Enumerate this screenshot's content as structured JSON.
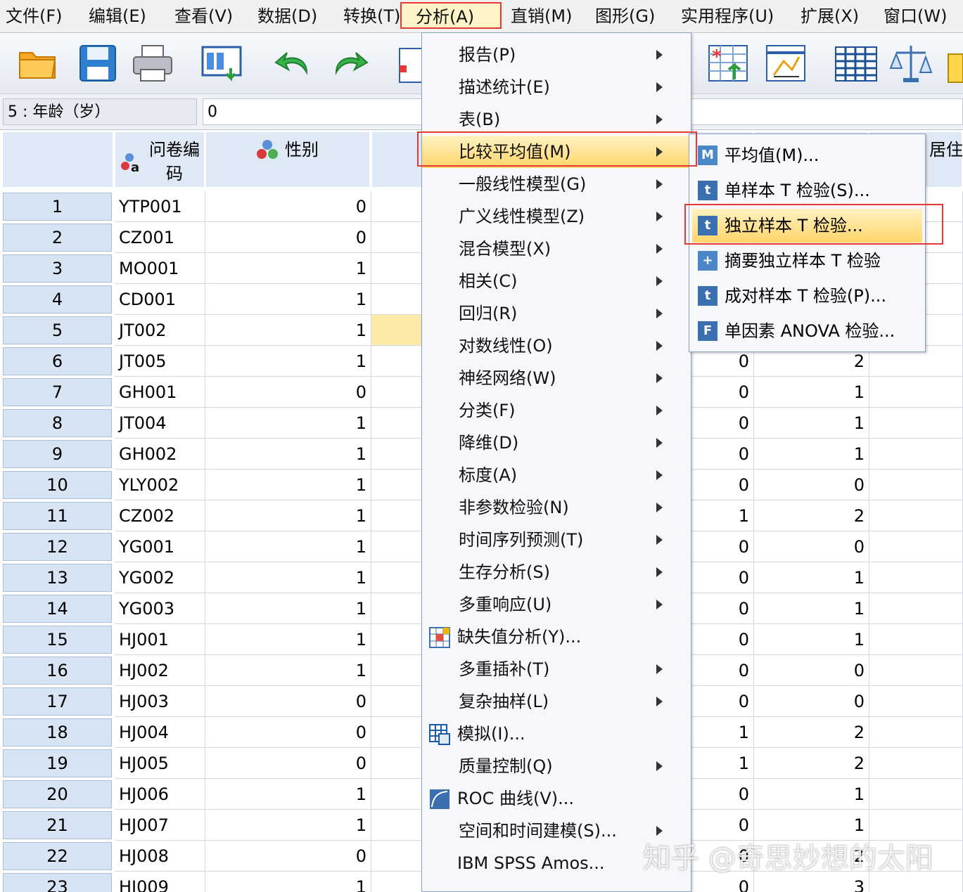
{
  "menubar": [
    {
      "label": "文件(F)",
      "active": false
    },
    {
      "label": "编辑(E)",
      "active": false
    },
    {
      "label": "查看(V)",
      "active": false
    },
    {
      "label": "数据(D)",
      "active": false
    },
    {
      "label": "转换(T)",
      "active": false
    },
    {
      "label": "分析(A)",
      "active": true
    },
    {
      "label": "直销(M)",
      "active": false
    },
    {
      "label": "图形(G)",
      "active": false
    },
    {
      "label": "实用程序(U)",
      "active": false
    },
    {
      "label": "扩展(X)",
      "active": false
    },
    {
      "label": "窗口(W)",
      "active": false
    }
  ],
  "toolbar": [
    "open-folder-icon",
    "save-icon",
    "print-icon",
    "dialog-recall-icon",
    "undo-icon",
    "redo-icon",
    "goto-case-icon",
    "select-cases-icon",
    "variables-icon",
    "split-file-icon",
    "weight-cases-icon",
    "value-labels-icon"
  ],
  "editor": {
    "cell_ref": "5 : 年龄（岁）",
    "cell_value": "0"
  },
  "columns": [
    {
      "label": "问卷编码",
      "icon": "string-variable-icon"
    },
    {
      "label": "性别",
      "icon": "nominal-variable-icon"
    },
    {
      "label": "居住"
    }
  ],
  "rows": [
    {
      "n": "1",
      "code": "YTP001",
      "sex": "0",
      "a": "",
      "b": ""
    },
    {
      "n": "2",
      "code": "CZ001",
      "sex": "0",
      "a": "",
      "b": ""
    },
    {
      "n": "3",
      "code": "MO001",
      "sex": "1",
      "a": "",
      "b": ""
    },
    {
      "n": "4",
      "code": "CD001",
      "sex": "1",
      "a": "",
      "b": ""
    },
    {
      "n": "5",
      "code": "JT002",
      "sex": "1",
      "a": "",
      "b": ""
    },
    {
      "n": "6",
      "code": "JT005",
      "sex": "1",
      "a": "0",
      "b": "2"
    },
    {
      "n": "7",
      "code": "GH001",
      "sex": "0",
      "a": "0",
      "b": "1"
    },
    {
      "n": "8",
      "code": "JT004",
      "sex": "1",
      "a": "0",
      "b": "1"
    },
    {
      "n": "9",
      "code": "GH002",
      "sex": "1",
      "a": "0",
      "b": "1"
    },
    {
      "n": "10",
      "code": "YLY002",
      "sex": "1",
      "a": "0",
      "b": "0"
    },
    {
      "n": "11",
      "code": "CZ002",
      "sex": "1",
      "a": "1",
      "b": "2"
    },
    {
      "n": "12",
      "code": "YG001",
      "sex": "1",
      "a": "0",
      "b": "0"
    },
    {
      "n": "13",
      "code": "YG002",
      "sex": "1",
      "a": "0",
      "b": "1"
    },
    {
      "n": "14",
      "code": "YG003",
      "sex": "1",
      "a": "0",
      "b": "1"
    },
    {
      "n": "15",
      "code": "HJ001",
      "sex": "1",
      "a": "0",
      "b": "1"
    },
    {
      "n": "16",
      "code": "HJ002",
      "sex": "1",
      "a": "0",
      "b": "0"
    },
    {
      "n": "17",
      "code": "HJ003",
      "sex": "0",
      "a": "0",
      "b": "0"
    },
    {
      "n": "18",
      "code": "HJ004",
      "sex": "0",
      "a": "1",
      "b": "2"
    },
    {
      "n": "19",
      "code": "HJ005",
      "sex": "0",
      "a": "1",
      "b": "2"
    },
    {
      "n": "20",
      "code": "HJ006",
      "sex": "1",
      "a": "0",
      "b": "1"
    },
    {
      "n": "21",
      "code": "HJ007",
      "sex": "1",
      "a": "0",
      "b": "1"
    },
    {
      "n": "22",
      "code": "HJ008",
      "sex": "0",
      "a": "0",
      "b": "2"
    },
    {
      "n": "23",
      "code": "HJ009",
      "sex": "1",
      "a": "0",
      "b": "3"
    }
  ],
  "analysis_menu": [
    {
      "label": "报告(P)",
      "submenu": true
    },
    {
      "label": "描述统计(E)",
      "submenu": true
    },
    {
      "label": "表(B)",
      "submenu": true
    },
    {
      "label": "比较平均值(M)",
      "submenu": true,
      "highlight": true
    },
    {
      "label": "一般线性模型(G)",
      "submenu": true
    },
    {
      "label": "广义线性模型(Z)",
      "submenu": true
    },
    {
      "label": "混合模型(X)",
      "submenu": true
    },
    {
      "label": "相关(C)",
      "submenu": true
    },
    {
      "label": "回归(R)",
      "submenu": true
    },
    {
      "label": "对数线性(O)",
      "submenu": true
    },
    {
      "label": "神经网络(W)",
      "submenu": true
    },
    {
      "label": "分类(F)",
      "submenu": true
    },
    {
      "label": "降维(D)",
      "submenu": true
    },
    {
      "label": "标度(A)",
      "submenu": true
    },
    {
      "label": "非参数检验(N)",
      "submenu": true
    },
    {
      "label": "时间序列预测(T)",
      "submenu": true
    },
    {
      "label": "生存分析(S)",
      "submenu": true
    },
    {
      "label": "多重响应(U)",
      "submenu": true
    },
    {
      "label": "缺失值分析(Y)...",
      "submenu": false,
      "icon": "missing-value-icon"
    },
    {
      "label": "多重插补(T)",
      "submenu": true
    },
    {
      "label": "复杂抽样(L)",
      "submenu": true
    },
    {
      "label": "模拟(I)...",
      "submenu": false,
      "icon": "simulation-icon"
    },
    {
      "label": "质量控制(Q)",
      "submenu": true
    },
    {
      "label": "ROC 曲线(V)...",
      "submenu": false,
      "icon": "roc-curve-icon"
    },
    {
      "label": "空间和时间建模(S)...",
      "submenu": true
    },
    {
      "label": "IBM SPSS Amos...",
      "submenu": false
    }
  ],
  "compare_means_submenu": [
    {
      "label": "平均值(M)...",
      "icon": "means-icon",
      "glyph": "M",
      "color": "#4a86c8"
    },
    {
      "label": "单样本 T 检验(S)...",
      "icon": "one-sample-t-icon",
      "glyph": "t",
      "color": "#3a6fb0"
    },
    {
      "label": "独立样本 T 检验...",
      "icon": "independent-t-icon",
      "glyph": "t",
      "color": "#3a6fb0",
      "highlight": true
    },
    {
      "label": "摘要独立样本 T 检验",
      "icon": "summary-t-icon",
      "glyph": "+",
      "color": "#4a86c8"
    },
    {
      "label": "成对样本 T 检验(P)...",
      "icon": "paired-t-icon",
      "glyph": "t",
      "color": "#3a6fb0"
    },
    {
      "label": "单因素 ANOVA 检验...",
      "icon": "anova-icon",
      "glyph": "F",
      "color": "#3a6fb0"
    }
  ],
  "watermark": "知乎 @奇思妙想的太阳"
}
